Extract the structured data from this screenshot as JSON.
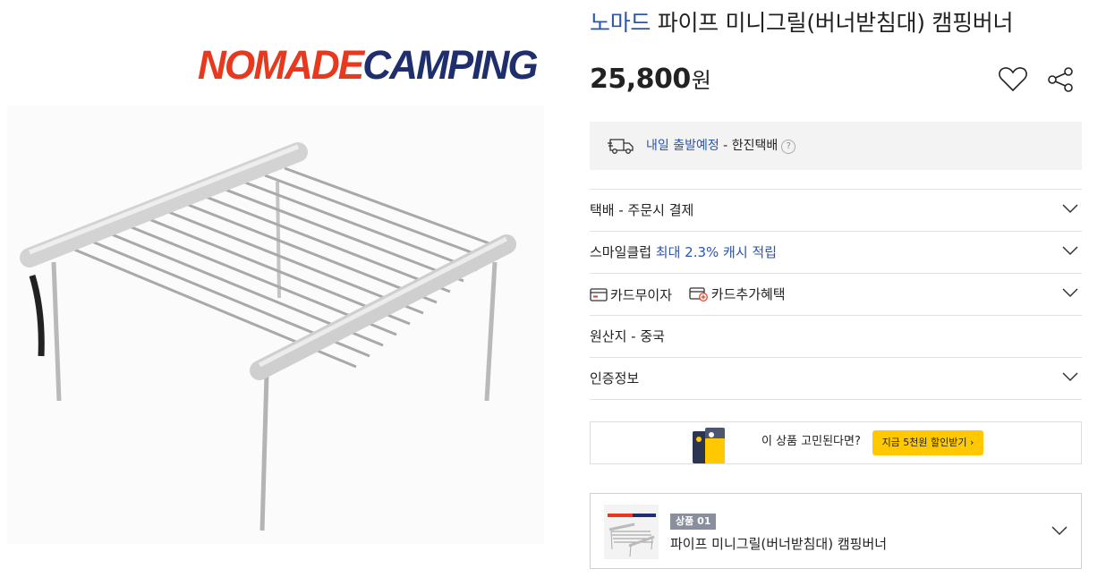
{
  "product": {
    "logo_part1": "NOMADE",
    "logo_part2": "CAMPING",
    "brand": "노마드",
    "title": "파이프 미니그릴(버너받침대) 캠핑버너",
    "price": "25,800",
    "currency": "원"
  },
  "shipping": {
    "highlight": "내일 출발예정",
    "separator": " - ",
    "carrier": "한진택배",
    "help": "?"
  },
  "rows": {
    "delivery": "택배 - 주문시 결제",
    "smileclub_prefix": "스마일클럽 ",
    "smileclub_highlight": "최대 2.3% 캐시 적립",
    "card_no_interest": "카드무이자",
    "card_extra_benefit": "카드추가혜택",
    "origin": "원산지 - 중국",
    "certification": "인증정보"
  },
  "promo": {
    "question": "이 상품 고민된다면?",
    "button": "지금 5천원 할인받기 ›"
  },
  "option": {
    "badge": "상품 01",
    "name": "파이프 미니그릴(버너받침대) 캠핑버너"
  },
  "colors": {
    "brand_blue": "#2d55a8",
    "logo_red": "#e8381e",
    "logo_navy": "#1f2f6d",
    "promo_yellow": "#ffc800"
  },
  "icons": [
    "heart-icon",
    "share-icon",
    "truck-icon",
    "help-icon",
    "chevron-down-icon",
    "card-icon",
    "card-plus-icon"
  ]
}
